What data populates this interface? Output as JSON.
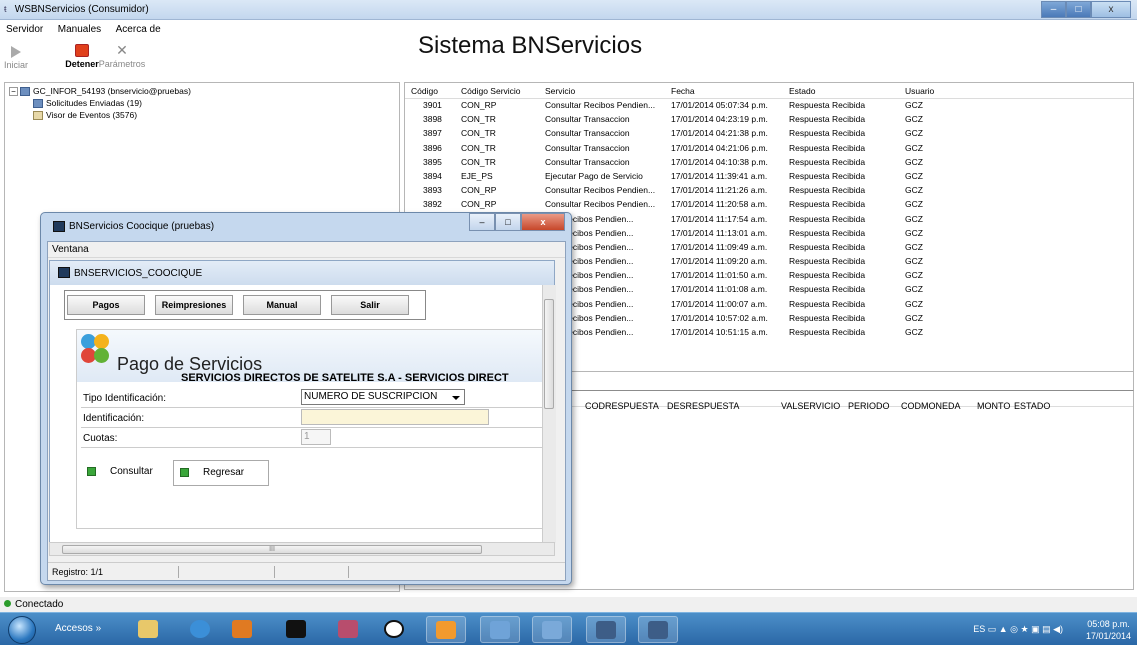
{
  "window": {
    "title": "WSBNServicios (Consumidor)",
    "min": "–",
    "max": "□",
    "close": "x"
  },
  "menu": [
    "Servidor",
    "Manuales",
    "Acerca de"
  ],
  "toolbar": {
    "start": "Iniciar",
    "stop": "Detener",
    "params": "Parámetros"
  },
  "header": "Sistema BNServicios",
  "tree": {
    "root": "GC_INFOR_54193 (bnservicio@pruebas)",
    "children": [
      "Solicitudes Enviadas (19)",
      "Visor de Eventos (3576)"
    ]
  },
  "grid": {
    "columns": [
      "Código",
      "Código Servicio",
      "Servicio",
      "Fecha",
      "Estado",
      "Usuario"
    ],
    "rows": [
      [
        "3901",
        "CON_RP",
        "Consultar Recibos Pendien...",
        "17/01/2014 05:07:34 p.m.",
        "Respuesta Recibida",
        "GCZ"
      ],
      [
        "3898",
        "CON_TR",
        "Consultar Transaccion",
        "17/01/2014 04:23:19 p.m.",
        "Respuesta Recibida",
        "GCZ"
      ],
      [
        "3897",
        "CON_TR",
        "Consultar Transaccion",
        "17/01/2014 04:21:38 p.m.",
        "Respuesta Recibida",
        "GCZ"
      ],
      [
        "3896",
        "CON_TR",
        "Consultar Transaccion",
        "17/01/2014 04:21:06 p.m.",
        "Respuesta Recibida",
        "GCZ"
      ],
      [
        "3895",
        "CON_TR",
        "Consultar Transaccion",
        "17/01/2014 04:10:38 p.m.",
        "Respuesta Recibida",
        "GCZ"
      ],
      [
        "3894",
        "EJE_PS",
        "Ejecutar Pago de Servicio",
        "17/01/2014 11:39:41 a.m.",
        "Respuesta Recibida",
        "GCZ"
      ],
      [
        "3893",
        "CON_RP",
        "Consultar Recibos Pendien...",
        "17/01/2014 11:21:26 a.m.",
        "Respuesta Recibida",
        "GCZ"
      ],
      [
        "3892",
        "CON_RP",
        "Consultar Recibos Pendien...",
        "17/01/2014 11:20:58 a.m.",
        "Respuesta Recibida",
        "GCZ"
      ],
      [
        "",
        "",
        "...ar Recibos Pendien...",
        "17/01/2014 11:17:54 a.m.",
        "Respuesta Recibida",
        "GCZ"
      ],
      [
        "",
        "",
        "...ar Recibos Pendien...",
        "17/01/2014 11:13:01 a.m.",
        "Respuesta Recibida",
        "GCZ"
      ],
      [
        "",
        "",
        "...ar Recibos Pendien...",
        "17/01/2014 11:09:49 a.m.",
        "Respuesta Recibida",
        "GCZ"
      ],
      [
        "",
        "",
        "...ar Recibos Pendien...",
        "17/01/2014 11:09:20 a.m.",
        "Respuesta Recibida",
        "GCZ"
      ],
      [
        "",
        "",
        "...ar Recibos Pendien...",
        "17/01/2014 11:01:50 a.m.",
        "Respuesta Recibida",
        "GCZ"
      ],
      [
        "",
        "",
        "...ar Recibos Pendien...",
        "17/01/2014 11:01:08 a.m.",
        "Respuesta Recibida",
        "GCZ"
      ],
      [
        "",
        "",
        "...ar Recibos Pendien...",
        "17/01/2014 11:00:07 a.m.",
        "Respuesta Recibida",
        "GCZ"
      ],
      [
        "",
        "",
        "...ar Recibos Pendien...",
        "17/01/2014 10:57:02 a.m.",
        "Respuesta Recibida",
        "GCZ"
      ],
      [
        "",
        "",
        "...ar Recibos Pendien...",
        "17/01/2014 10:51:15 a.m.",
        "Respuesta Recibida",
        "GCZ"
      ]
    ]
  },
  "grid2": {
    "columns": [
      "CODRESPUESTA",
      "DESRESPUESTA",
      "VALSERVICIO",
      "PERIODO",
      "CODMONEDA",
      "MONTO",
      "ESTADO"
    ]
  },
  "status": "Conectado",
  "dialog": {
    "title": "BNServicios Coocique (pruebas)",
    "menu": "Ventana",
    "mdi_title": "BNSERVICIOS_COOCIQUE",
    "buttons": [
      "Pagos",
      "Reimpresiones",
      "Manual",
      "Salir"
    ],
    "heading": "Pago de Servicios",
    "provider": "SERVICIOS DIRECTOS DE SATELITE S.A - SERVICIOS DIRECT",
    "form": {
      "tipo_label": "Tipo Identificación:",
      "tipo_value": "NUMERO DE SUSCRIPCION",
      "id_label": "Identificación:",
      "id_value": "",
      "cuotas_label": "Cuotas:",
      "cuotas_value": "1"
    },
    "consultar": "Consultar",
    "regresar": "Regresar",
    "hscroll_label": "III",
    "registro": "Registro: 1/1"
  },
  "taskbar": {
    "accesos": "Accesos",
    "tray": "ES",
    "time": "05:08 p.m.",
    "date": "17/01/2014"
  }
}
